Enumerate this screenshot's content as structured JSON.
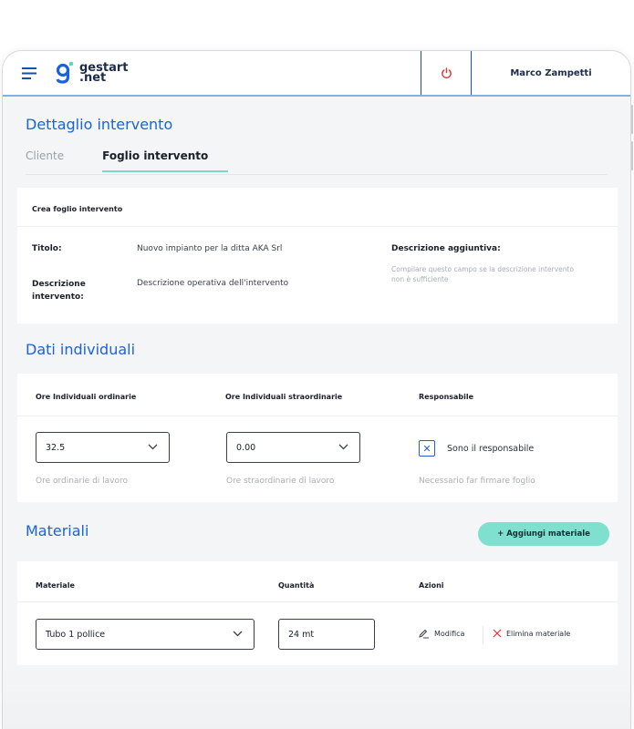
{
  "header": {
    "logo_line1": "gestart",
    "logo_line2": ".net",
    "user_name": "Marco Zampetti"
  },
  "page": {
    "title": "Dettaglio intervento",
    "tabs": [
      {
        "label": "Cliente",
        "active": false
      },
      {
        "label": "Foglio intervento",
        "active": true
      }
    ]
  },
  "foglio": {
    "card_title": "Crea foglio intervento",
    "titolo_label": "Titolo:",
    "titolo_value": "Nuovo impianto per la ditta AKA Srl",
    "descrizione_label": "Descrizione intervento:",
    "descrizione_value": "Descrizione operativa dell'intervento",
    "aggiuntiva_label": "Descrizione aggiuntiva:",
    "aggiuntiva_hint": "Compilare questo campo se la descrizione intervento non è sufficiente"
  },
  "dati": {
    "title": "Dati individuali",
    "col_ordinarie": "Ore Individuali ordinarie",
    "col_straordinarie": "Ore Individuali straordinarie",
    "col_responsabile": "Responsabile",
    "ordinarie_value": "32.5",
    "straordinarie_value": "0.00",
    "responsabile_label": "Sono il responsabile",
    "responsabile_checked": true,
    "ordinarie_hint": "Ore ordinarie di lavoro",
    "straordinarie_hint": "Ore straordinarie di lavoro",
    "responsabile_hint": "Necessario far firmare foglio"
  },
  "materiali": {
    "title": "Materiali",
    "add_label": "+ Aggiungi materiale",
    "col_materiale": "Materiale",
    "col_quantita": "Quantità",
    "col_azioni": "Azioni",
    "rows": [
      {
        "materiale": "Tubo 1 pollice",
        "quantita": "24 mt",
        "modifica": "Modifica",
        "elimina": "Elimina materiale"
      }
    ]
  },
  "colors": {
    "accent_blue": "#1a63d8",
    "accent_mint": "#7fe0d0",
    "danger": "#e0333a"
  },
  "icons": [
    "hamburger-icon",
    "power-icon",
    "chevron-down-icon",
    "check-icon",
    "pencil-icon",
    "x-icon"
  ]
}
